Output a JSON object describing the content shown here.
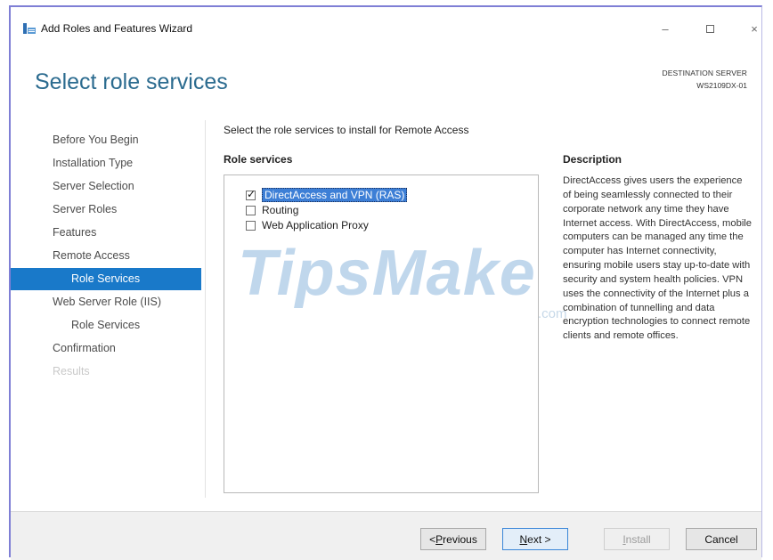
{
  "window": {
    "title": "Add Roles and Features Wizard",
    "controls": {
      "minimize": "–",
      "close": "×"
    }
  },
  "header": {
    "page_title": "Select role services",
    "destination_label": "DESTINATION SERVER",
    "destination_server": "WS2109DX-01"
  },
  "nav": {
    "items": [
      {
        "label": "Before You Begin"
      },
      {
        "label": "Installation Type"
      },
      {
        "label": "Server Selection"
      },
      {
        "label": "Server Roles"
      },
      {
        "label": "Features"
      },
      {
        "label": "Remote Access"
      },
      {
        "label": "Role Services"
      },
      {
        "label": "Web Server Role (IIS)"
      },
      {
        "label": "Role Services"
      },
      {
        "label": "Confirmation"
      },
      {
        "label": "Results"
      }
    ]
  },
  "main": {
    "instruction": "Select the role services to install for Remote Access",
    "role_services_heading": "Role services",
    "role_services": [
      {
        "label": "DirectAccess and VPN (RAS)",
        "checked": true
      },
      {
        "label": "Routing",
        "checked": false
      },
      {
        "label": "Web Application Proxy",
        "checked": false
      }
    ],
    "description_heading": "Description",
    "description": "DirectAccess gives users the experience of being seamlessly connected to their corporate network any time they have Internet access. With DirectAccess, mobile computers can be managed any time the computer has Internet connectivity, ensuring mobile users stay up-to-date with security and system health policies. VPN uses the connectivity of the Internet plus a combination of tunnelling and data encryption technologies to connect remote clients and remote offices."
  },
  "watermark": {
    "text": "TipsMake",
    "tld": ".com"
  },
  "footer": {
    "previous_prefix": "< ",
    "previous_key": "P",
    "previous_rest": "revious",
    "next_key": "N",
    "next_rest": "ext >",
    "install_key": "I",
    "install_rest": "nstall",
    "cancel": "Cancel"
  },
  "colors": {
    "accent": "#1979c9",
    "title": "#2b6b8f",
    "selection": "#3d7fd6"
  }
}
